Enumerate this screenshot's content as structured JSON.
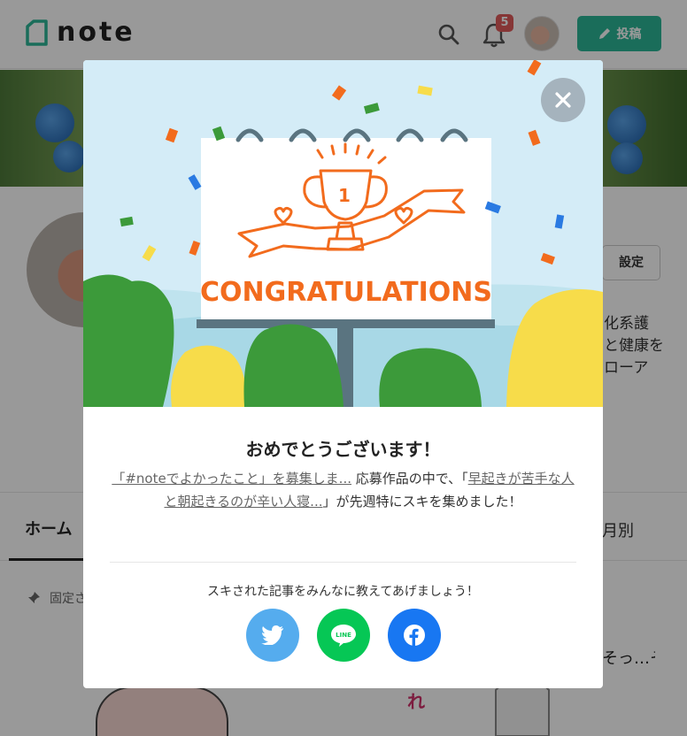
{
  "header": {
    "logo_text": "note",
    "notification_count": "5",
    "post_label": "投稿"
  },
  "profile": {
    "settings_label": "設定",
    "bio_lines": [
      "化系護",
      "と健康を",
      "ローア"
    ]
  },
  "tabs": {
    "home": "ホーム",
    "monthly": "月別"
  },
  "pinned_label": "固定さ",
  "modal": {
    "title": "おめでとうございます！",
    "banner_text": "CONGRATULATIONS",
    "body_link1": "「#noteでよかったこと」を募集しま...",
    "body_mid": " 応募作品の中で、「",
    "body_link2": "早起きが苦手な人と朝起きるのが辛い人寝...",
    "body_end": "」が先週特にスキを集めました！",
    "share_prompt": "スキされた記事をみんなに教えてあげましょう！",
    "share": [
      {
        "name": "twitter",
        "color": "#55acee"
      },
      {
        "name": "line",
        "color": "#06c755",
        "label": "LINE"
      },
      {
        "name": "facebook",
        "color": "#1877f2"
      }
    ]
  },
  "colors": {
    "accent": "#2cb696",
    "banner_orange": "#f26b1d"
  }
}
